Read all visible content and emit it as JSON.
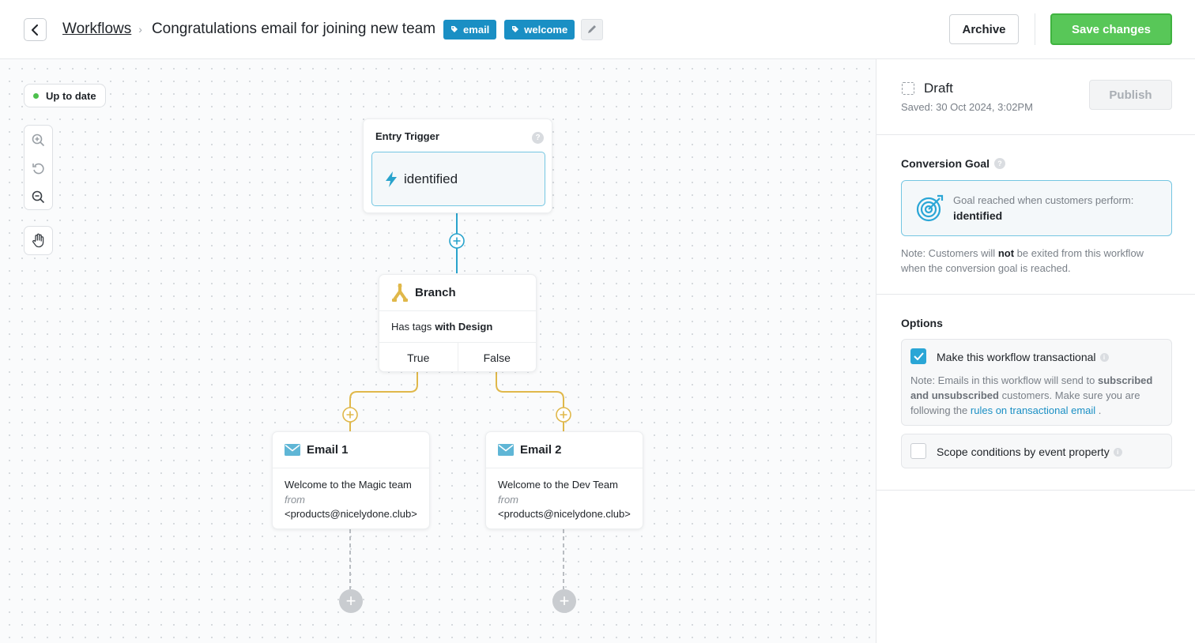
{
  "header": {
    "breadcrumb_root": "Workflows",
    "separator": "›",
    "title": "Congratulations email for joining new team",
    "tags": [
      "email",
      "welcome"
    ],
    "archive_label": "Archive",
    "save_label": "Save changes"
  },
  "canvas": {
    "status": "Up to date",
    "trigger": {
      "title": "Entry Trigger",
      "help": "?",
      "event": "identified"
    },
    "branch": {
      "title": "Branch",
      "condition_prefix": "Has tags",
      "condition_value": "with Design",
      "true_label": "True",
      "false_label": "False"
    },
    "emails": [
      {
        "title": "Email 1",
        "subject": "Welcome to the Magic team",
        "from_label": "from",
        "from": "<products@nicelydone.club>"
      },
      {
        "title": "Email 2",
        "subject": "Welcome to the Dev Team",
        "from_label": "from",
        "from": "<products@nicelydone.club>"
      }
    ],
    "add_symbol": "+"
  },
  "panel": {
    "draft_label": "Draft",
    "saved": "Saved: 30 Oct 2024, 3:02PM",
    "publish_label": "Publish",
    "goal_title": "Conversion Goal",
    "goal_desc": "Goal reached when customers perform:",
    "goal_event": "identified",
    "goal_note_pre": "Note: Customers will",
    "goal_note_bold": "not",
    "goal_note_post": "be exited from this workflow when the conversion goal is reached.",
    "options_title": "Options",
    "opt_transactional": "Make this workflow transactional",
    "opt_transactional_checked": true,
    "opt_note_pre": "Note: Emails in this workflow will send to",
    "opt_note_bold": "subscribed and unsubscribed",
    "opt_note_mid": "customers. Make sure you are following the",
    "opt_note_link": "rules on transactional email",
    "opt_note_end": ".",
    "opt_scope": "Scope conditions by event property",
    "opt_scope_checked": false
  },
  "colors": {
    "accent": "#1a8fc4",
    "save_green": "#58c758",
    "trigger_wire": "#29a3cc",
    "branch_wire": "#e0b84a"
  }
}
